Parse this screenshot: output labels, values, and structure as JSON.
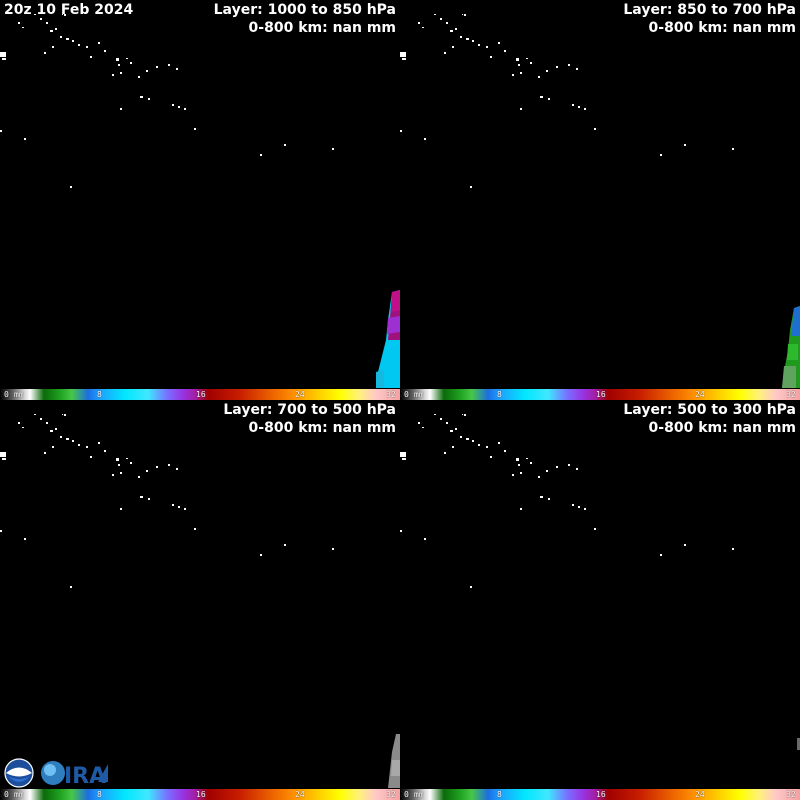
{
  "timestamp": "20z 10 Feb 2024",
  "panels": [
    {
      "layer": "Layer: 1000 to 850 hPa",
      "summary": "0-800 km: nan mm"
    },
    {
      "layer": "Layer: 850 to 700 hPa",
      "summary": "0-800 km: nan mm"
    },
    {
      "layer": "Layer: 700 to 500 hPa",
      "summary": "0-800 km: nan mm"
    },
    {
      "layer": "Layer: 500 to 300 hPa",
      "summary": "0-800 km: nan mm"
    }
  ],
  "colorbar": {
    "ticks": [
      "0",
      "mm",
      "8",
      "16",
      "24",
      "32"
    ],
    "range_mm": [
      0,
      32
    ]
  },
  "logos": [
    "noaa-logo",
    "cira-logo"
  ],
  "colors": {
    "background": "#000000",
    "land_outline": "#ffffff",
    "magenta": "#a0117e",
    "cyan": "#00c8f0",
    "green": "#1f9a1f",
    "blue": "#1f6fd0",
    "gray": "#8a8a8a"
  }
}
